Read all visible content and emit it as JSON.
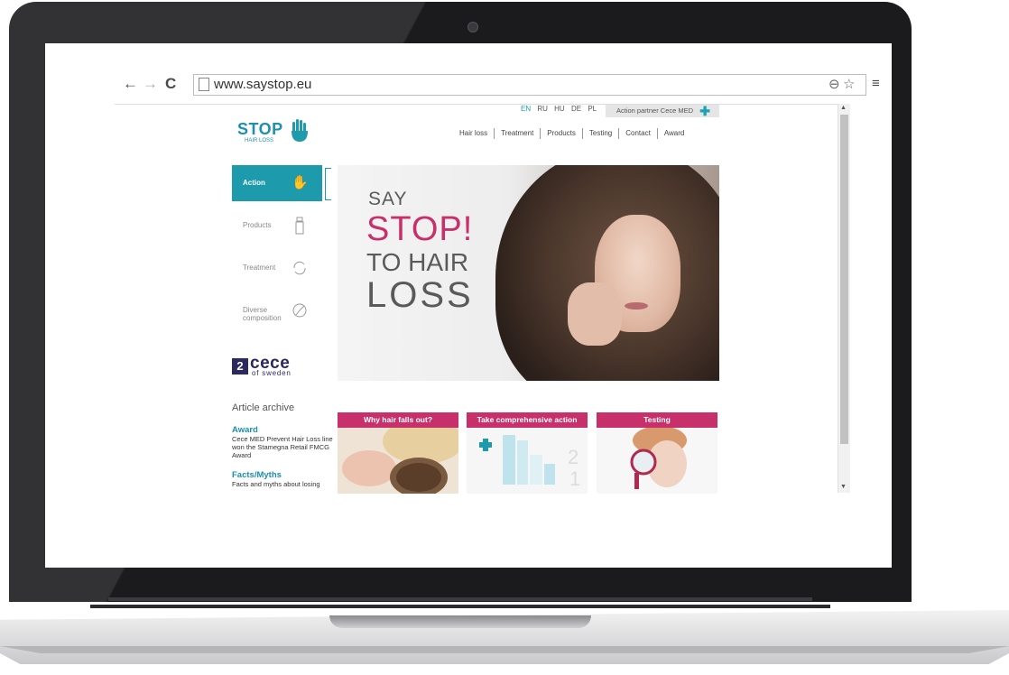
{
  "browser": {
    "url": "www.saystop.eu",
    "back_icon": "←",
    "forward_icon": "→",
    "reload_icon": "C",
    "zoom_icon": "⊖",
    "star_icon": "☆",
    "menu_icon": "≡"
  },
  "site": {
    "languages": [
      "EN",
      "RU",
      "HU",
      "DE",
      "PL"
    ],
    "active_language": "EN",
    "partner_label": "Action partner Cece MED",
    "logo": {
      "main": "STOP",
      "sub": "HAIR LOSS"
    },
    "nav": [
      "Hair loss",
      "Treatment",
      "Products",
      "Testing",
      "Contact",
      "Award"
    ],
    "sidebar": [
      {
        "label": "Action",
        "icon": "hand-icon",
        "active": true
      },
      {
        "label": "Products",
        "icon": "spray-bottle-icon",
        "active": false
      },
      {
        "label": "Treatment",
        "icon": "refresh-icon",
        "active": false
      },
      {
        "label": "Diverse composition",
        "icon": "pie-icon",
        "active": false
      }
    ],
    "sidebar_labels": {
      "action": "Action",
      "products": "Products",
      "treatment": "Treatment",
      "diverse1": "Diverse",
      "diverse2": "composition"
    },
    "cece": {
      "mark": "2",
      "name": "cece",
      "sub": "of sweden"
    },
    "archive": {
      "title": "Article archive",
      "items": [
        {
          "title": "Award",
          "text": "Cece MED Prevent Hair Loss line won the Stamegna Retail FMCG Award"
        },
        {
          "title": "Facts/Myths",
          "text": "Facts and myths about losing"
        }
      ]
    },
    "hero": {
      "line1": "SAY",
      "line2": "STOP!",
      "line3": "TO HAIR",
      "line4": "LOSS"
    },
    "cards": [
      {
        "title": "Why hair falls out?"
      },
      {
        "title": "Take comprehensive action"
      },
      {
        "title": "Testing"
      }
    ]
  },
  "colors": {
    "teal": "#1d9aab",
    "magenta": "#c7306a",
    "navy": "#2b2a5e"
  }
}
